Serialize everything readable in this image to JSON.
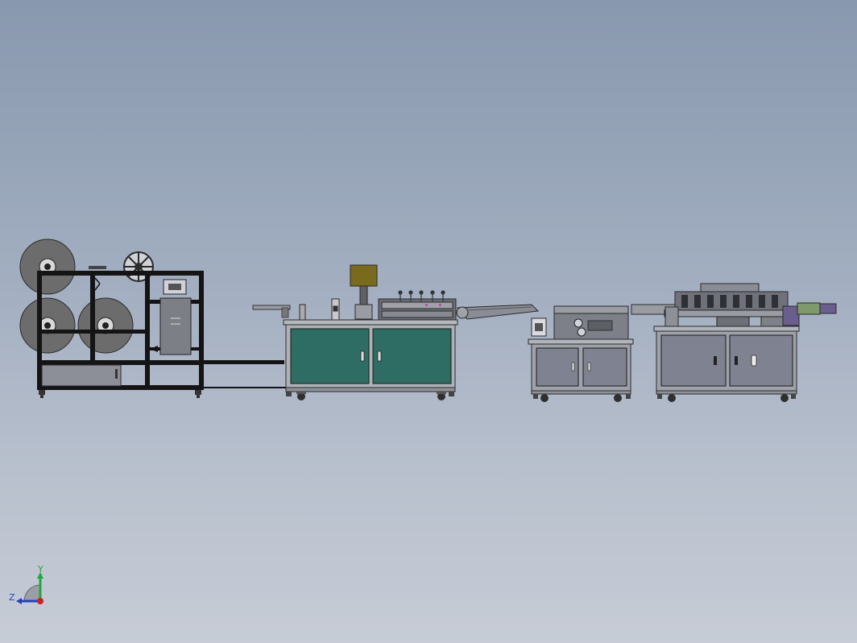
{
  "triad": {
    "y_label": "Y",
    "z_label": "Z",
    "y_color": "#1fa83a",
    "z_color": "#2540c8",
    "x_color": "#d01f1f"
  },
  "palette": {
    "background_top": "#8898ae",
    "background_bottom": "#c7ccd6",
    "frame_black": "#141414",
    "roll_grey": "#6e6e6e",
    "cabinet_teal": "#2e6d63",
    "cabinet_grey": "#7f8290",
    "top_box_olive": "#7a6a1c",
    "output_green": "#7f9a6a",
    "output_purple": "#6a5e8e"
  }
}
